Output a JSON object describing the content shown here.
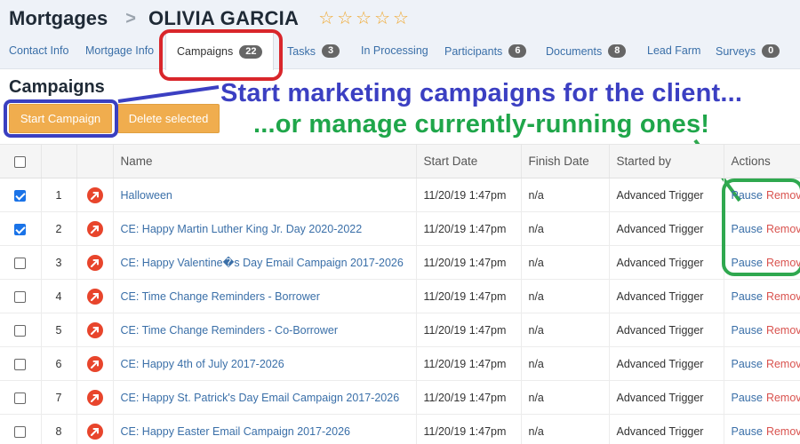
{
  "breadcrumb": {
    "root": "Mortgages",
    "separator": ">",
    "name": "OLIVIA GARCIA"
  },
  "rating": {
    "stars_total": 5,
    "stars_filled": 0
  },
  "tabs": [
    {
      "label": "Contact Info",
      "badge": null
    },
    {
      "label": "Mortgage Info",
      "badge": null
    },
    {
      "label": "Campaigns",
      "badge": "22",
      "active": true
    },
    {
      "label": "Tasks",
      "badge": "3"
    },
    {
      "label": "In Processing",
      "badge": null
    },
    {
      "label": "Participants",
      "badge": "6"
    },
    {
      "label": "Documents",
      "badge": "8"
    },
    {
      "label": "Lead Farm",
      "badge": null
    },
    {
      "label": "Surveys",
      "badge": "0"
    }
  ],
  "section_title": "Campaigns",
  "buttons": {
    "start": "Start Campaign",
    "delete": "Delete selected"
  },
  "annotations": {
    "line1": "Start marketing campaigns for the client...",
    "line2": "...or manage currently-running ones!"
  },
  "table": {
    "columns": [
      "Name",
      "Start Date",
      "Finish Date",
      "Started by",
      "Actions"
    ],
    "action_labels": {
      "pause": "Pause",
      "remove": "Remove"
    },
    "rows": [
      {
        "num": "1",
        "checked": true,
        "name": "Halloween",
        "start": "11/20/19 1:47pm",
        "finish": "n/a",
        "by": "Advanced Trigger"
      },
      {
        "num": "2",
        "checked": true,
        "name": "CE: Happy Martin Luther King Jr. Day 2020-2022",
        "start": "11/20/19 1:47pm",
        "finish": "n/a",
        "by": "Advanced Trigger"
      },
      {
        "num": "3",
        "checked": false,
        "name": "CE: Happy Valentine�s Day Email Campaign 2017-2026",
        "start": "11/20/19 1:47pm",
        "finish": "n/a",
        "by": "Advanced Trigger"
      },
      {
        "num": "4",
        "checked": false,
        "name": "CE: Time Change Reminders - Borrower",
        "start": "11/20/19 1:47pm",
        "finish": "n/a",
        "by": "Advanced Trigger"
      },
      {
        "num": "5",
        "checked": false,
        "name": "CE: Time Change Reminders - Co-Borrower",
        "start": "11/20/19 1:47pm",
        "finish": "n/a",
        "by": "Advanced Trigger"
      },
      {
        "num": "6",
        "checked": false,
        "name": "CE: Happy 4th of July 2017-2026",
        "start": "11/20/19 1:47pm",
        "finish": "n/a",
        "by": "Advanced Trigger"
      },
      {
        "num": "7",
        "checked": false,
        "name": "CE: Happy St. Patrick's Day Email Campaign 2017-2026",
        "start": "11/20/19 1:47pm",
        "finish": "n/a",
        "by": "Advanced Trigger"
      },
      {
        "num": "8",
        "checked": false,
        "name": "CE: Happy Easter Email Campaign 2017-2026",
        "start": "11/20/19 1:47pm",
        "finish": "n/a",
        "by": "Advanced Trigger"
      }
    ]
  },
  "colors": {
    "annotation_blue": "#3b3fc2",
    "annotation_green": "#1fa64a",
    "highlight_red": "#d9262b",
    "button_orange": "#f0ad4e",
    "link_blue": "#3a6fa8",
    "remove_red": "#d9534f"
  }
}
